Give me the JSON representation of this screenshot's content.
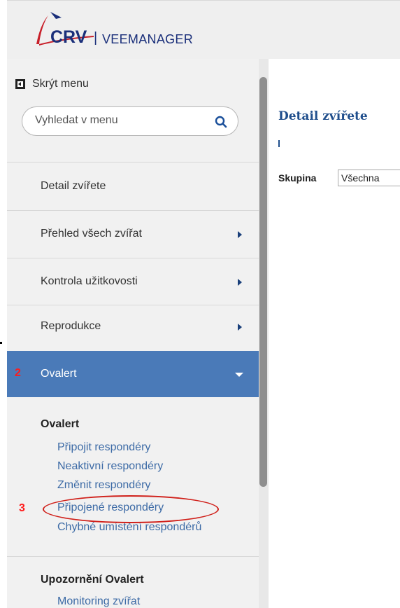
{
  "app": {
    "brand": "CRV",
    "separator": "|",
    "product": "VEEMANAGER"
  },
  "sidebar": {
    "hide_menu_label": "Skrýt menu",
    "search_placeholder": "Vyhledat v menu",
    "items": [
      {
        "label": "Detail zvířete",
        "has_arrow": false
      },
      {
        "label": "Přehled všech zvířat",
        "has_arrow": true
      },
      {
        "label": "Kontrola užitkovosti",
        "has_arrow": true
      },
      {
        "label": "Reprodukce",
        "has_arrow": true
      }
    ],
    "active": {
      "marker": "2",
      "label": "Ovalert"
    },
    "submenu": {
      "section1_title": "Ovalert",
      "section1_links": [
        "Připojit respondéry",
        "Neaktivní respondéry",
        "Změnit respondéry",
        "Připojené respondéry",
        "Chybné umístění respondérů"
      ],
      "highlight_marker": "3",
      "section2_title": "Upozornění Ovalert",
      "section2_links": [
        "Monitoring zvířat"
      ]
    }
  },
  "main": {
    "title": "Detail zvířete",
    "group_label": "Skupina",
    "group_value": "Všechna"
  },
  "colors": {
    "brand_blue": "#1a2f7a",
    "brand_red": "#c8202a",
    "active_bg": "#4a7ab8",
    "link": "#3d6ba6",
    "annotation_red": "#d0201a"
  }
}
